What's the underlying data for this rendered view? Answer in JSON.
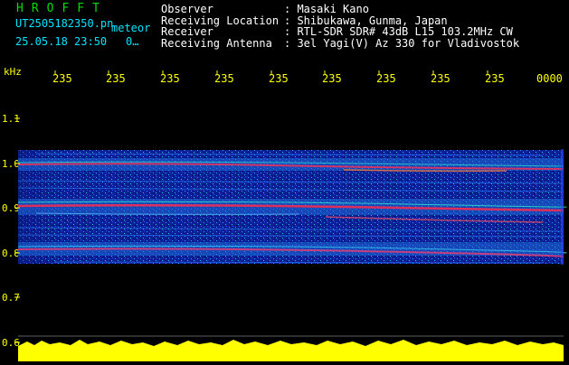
{
  "header": {
    "title": "HROFFT",
    "filename": "UT2505182350.pn",
    "meteor_label": "meteor",
    "datetime": "25.05.18 23:50",
    "counter": "0…"
  },
  "station": [
    {
      "key": "Observer",
      "value": ": Masaki Kano"
    },
    {
      "key": "Receiving Location",
      "value": ": Shibukawa, Gunma, Japan"
    },
    {
      "key": "Receiver",
      "value": ": RTL-SDR SDR# 43dB L15 103.2MHz CW"
    },
    {
      "key": "Receiving Antenna",
      "value": ": 3el Yagi(V) Az 330 for Vladivostok"
    }
  ],
  "axis": {
    "unit": "kHz",
    "time_ticks": [
      "235",
      "235",
      "235",
      "235",
      "235",
      "235",
      "235",
      "235",
      "235",
      "0000"
    ],
    "freq_labels": [
      "1.1",
      "1.0",
      "0.9",
      "0.8",
      "0.7",
      "0.6"
    ]
  },
  "colors": {
    "background": "#000000",
    "header_text": "#00e5ff",
    "info_text": "#ffffff",
    "tick_text": "#ffff00",
    "title_text": "#00dd00",
    "waterfall_base": "#0a1a8a",
    "signal_hot": "#ff2a4a",
    "noise_floor": "#ffff00"
  },
  "spectrogram": {
    "bands_khz": [
      1.0,
      0.9,
      0.8
    ],
    "range_khz": [
      0.6,
      1.15
    ]
  }
}
